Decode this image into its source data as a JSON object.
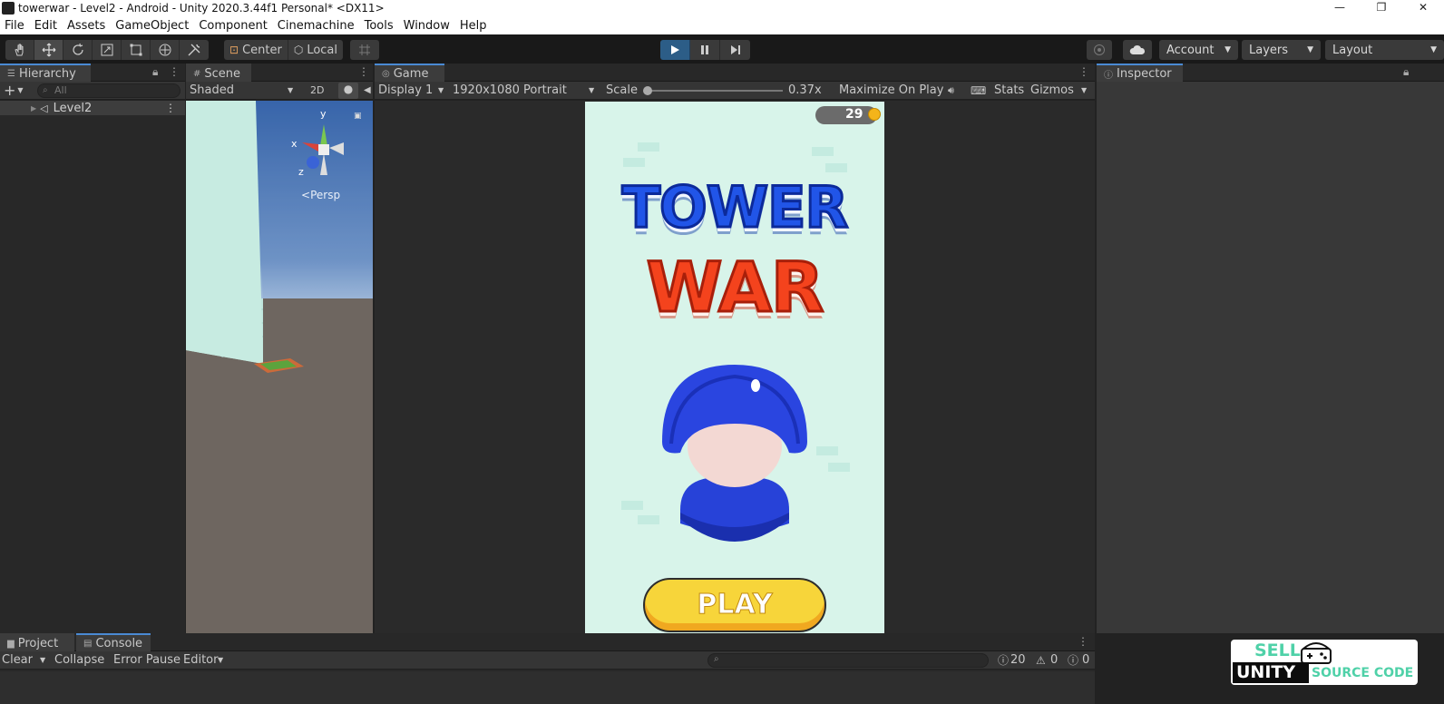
{
  "window": {
    "title": "towerwar - Level2 - Android - Unity 2020.3.44f1 Personal* <DX11>",
    "controls": [
      "—",
      "❐",
      "✕"
    ]
  },
  "menu": [
    "File",
    "Edit",
    "Assets",
    "GameObject",
    "Component",
    "Cinemachine",
    "Tools",
    "Window",
    "Help"
  ],
  "toolbar": {
    "pivot_label": "Center",
    "space_label": "Local",
    "account_label": "Account",
    "layers_label": "Layers",
    "layout_label": "Layout"
  },
  "hierarchy": {
    "tab_label": "Hierarchy",
    "search_placeholder": "All",
    "root_item": "Level2"
  },
  "scene": {
    "tab_label": "Scene",
    "shading_mode": "Shaded",
    "mode_2d": "2D",
    "gizmo_axes": [
      "y",
      "x",
      "z"
    ],
    "projection_label": "Persp"
  },
  "game": {
    "tab_label": "Game",
    "display": "Display 1",
    "resolution": "1920x1080 Portrait",
    "scale_label": "Scale",
    "scale_value": "0.37x",
    "scale_fraction": 0.0,
    "maximize_label": "Maximize On Play",
    "stats_label": "Stats",
    "gizmos_label": "Gizmos",
    "coins": "29",
    "title_line1": "TOWER",
    "title_line2": "WAR",
    "play_label": "PLAY"
  },
  "inspector": {
    "tab_label": "Inspector"
  },
  "bottom": {
    "project_tab": "Project",
    "console_tab": "Console",
    "clear_label": "Clear",
    "collapse_label": "Collapse",
    "error_pause_label": "Error Pause",
    "editor_label": "Editor",
    "log_count": "20",
    "warning_count": "0",
    "error_count": "0"
  },
  "watermark": {
    "line_sell": "SELL",
    "line_unity": "UNITY",
    "line_source": "SOURCE CODE"
  },
  "colors": {
    "accent_blue": "#4a8ad4",
    "play_active": "#2c5d87",
    "game_bg": "#d8f4ea",
    "title_blue": "#1f4fe0",
    "title_red": "#f2421c",
    "play_button": "#f7d53a"
  }
}
